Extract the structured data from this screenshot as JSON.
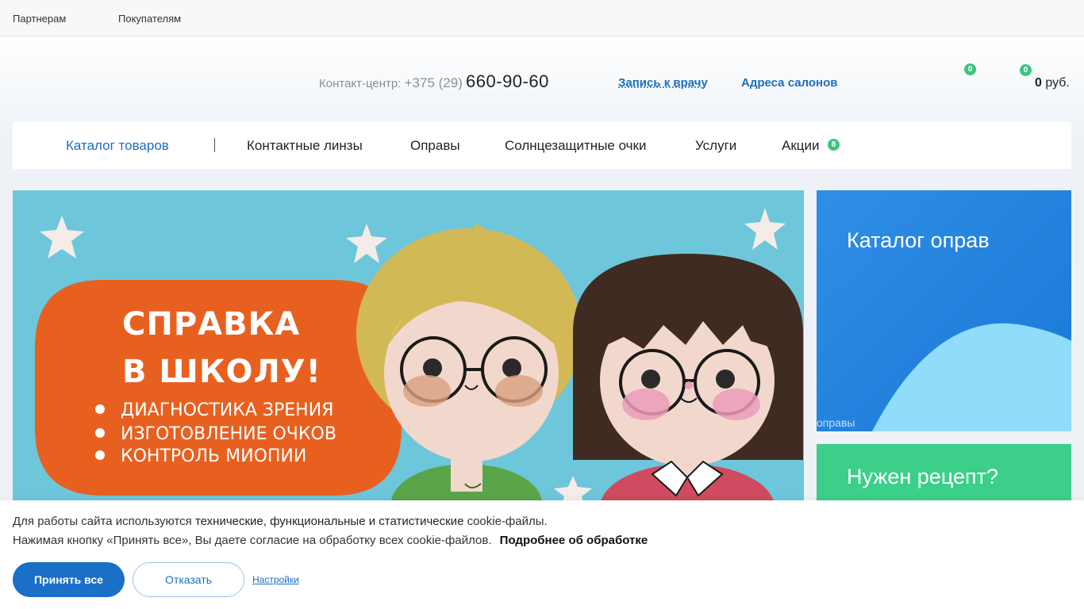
{
  "topbar": {
    "partners": "Партнерам",
    "buyers": "Покупателям"
  },
  "header": {
    "contact_label": "Контакт-центр:",
    "phone_code": "+375 (29)",
    "phone_number": "660-90-60",
    "appointment_link": "Запись к врачу",
    "salons_link": "Адреса салонов",
    "favorites_count": "0",
    "cart_count": "0",
    "cart_amount": "0",
    "cart_currency": "руб."
  },
  "nav": {
    "items": [
      {
        "label": "Каталог товаров"
      },
      {
        "label": "Контактные линзы"
      },
      {
        "label": "Оправы"
      },
      {
        "label": "Солнцезащитные очки"
      },
      {
        "label": "Услуги"
      },
      {
        "label": "Акции"
      }
    ],
    "promo_badge": "8"
  },
  "banner": {
    "title_line1": "СПРАВКА",
    "title_line2": "В ШКОЛУ!",
    "bullets": [
      "ДИАГНОСТИКА ЗРЕНИЯ",
      "ИЗГОТОВЛЕНИЕ ОЧКОВ",
      "КОНТРОЛЬ МИОПИИ"
    ]
  },
  "side_cards": {
    "frames_title": "Каталог оправ",
    "frames_img_alt": "оправы",
    "prescription_title": "Нужен рецепт?"
  },
  "cookie": {
    "line1_start": "Для работы сайта используются",
    "line1_strong": "технические, функциональные и статистические",
    "line1_end": "cookie-файлы.",
    "line2": "Нажимая кнопку «Принять все», Вы даете согласие на обработку всех cookie-файлов.",
    "more_link": "Подробнее об обработке",
    "accept_button": "Принять все",
    "decline_button": "Отказать",
    "settings_link": "Настройки"
  },
  "colors": {
    "brand_blue": "#1b6fbf",
    "badge_green": "#3dc57f",
    "banner_bg": "#6ec6da",
    "banner_orange": "#e8601f"
  }
}
